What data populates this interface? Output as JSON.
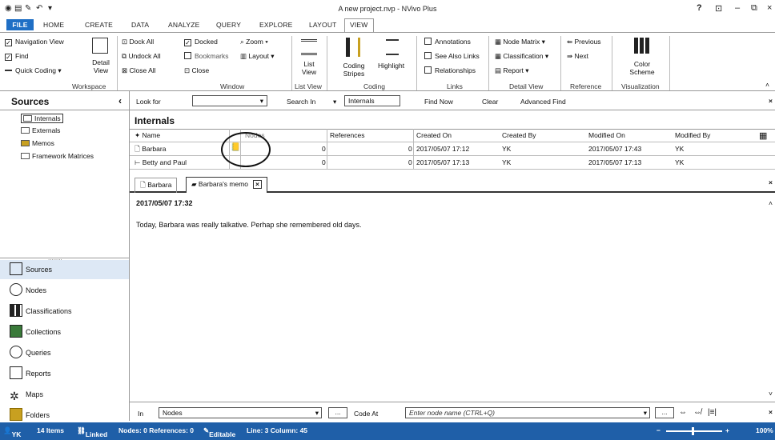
{
  "window": {
    "title": "A new project.nvp - NVivo Plus",
    "help": "?",
    "minimize": "–",
    "restore": "⊡",
    "close": "×"
  },
  "tabs": [
    "FILE",
    "HOME",
    "CREATE",
    "DATA",
    "ANALYZE",
    "QUERY",
    "EXPLORE",
    "LAYOUT",
    "VIEW"
  ],
  "active_tab": "VIEW",
  "ribbon": {
    "workspace": {
      "label": "Workspace",
      "items": [
        "Navigation View",
        "Find",
        "Quick Coding"
      ],
      "detail_view": "Detail View"
    },
    "window": {
      "label": "Window",
      "items": [
        "Dock All",
        "Undock All",
        "Close All",
        "Docked",
        "Bookmarks",
        "Close",
        "Zoom",
        "Layout"
      ]
    },
    "list_view": {
      "label": "List View",
      "button": "List View"
    },
    "coding": {
      "label": "Coding",
      "stripes": "Coding Stripes",
      "highlight": "Highlight"
    },
    "links": {
      "label": "Links",
      "items": [
        "Annotations",
        "See Also Links",
        "Relationships"
      ]
    },
    "detail_view": {
      "label": "Detail View",
      "items": [
        "Node Matrix",
        "Classification",
        "Report"
      ]
    },
    "reference": {
      "label": "Reference",
      "items": [
        "Previous",
        "Next"
      ]
    },
    "visualization": {
      "label": "Visualization",
      "button": "Color Scheme"
    }
  },
  "sources": {
    "header": "Sources",
    "tree": [
      "Internals",
      "Externals",
      "Memos",
      "Framework Matrices"
    ]
  },
  "nav": [
    "Sources",
    "Nodes",
    "Classifications",
    "Collections",
    "Queries",
    "Reports",
    "Maps",
    "Folders"
  ],
  "findbar": {
    "look_for": "Look for",
    "search_in": "Search In",
    "search_in_value": "Internals",
    "find_now": "Find Now",
    "clear": "Clear",
    "advanced": "Advanced Find"
  },
  "list": {
    "title": "Internals",
    "columns": [
      "Name",
      "Nodes",
      "References",
      "Created On",
      "Created By",
      "Modified On",
      "Modified By"
    ],
    "rows": [
      {
        "name": "Barbara",
        "nodes": "0",
        "references": "0",
        "created_on": "2017/05/07 17:12",
        "created_by": "YK",
        "modified_on": "2017/05/07 17:43",
        "modified_by": "YK"
      },
      {
        "name": "Betty and Paul",
        "nodes": "0",
        "references": "0",
        "created_on": "2017/05/07 17:13",
        "created_by": "YK",
        "modified_on": "2017/05/07 17:13",
        "modified_by": "YK"
      }
    ]
  },
  "doc_tabs": [
    "Barbara",
    "Barbara's memo"
  ],
  "doc": {
    "timestamp": "2017/05/07 17:32",
    "text": "Today, Barbara was really talkative. Perhap she remembered old days."
  },
  "bottombar": {
    "in": "In",
    "in_value": "Nodes",
    "code_at": "Code At",
    "placeholder": "Enter node name (CTRL+Q)",
    "more": "..."
  },
  "status": {
    "user": "YK",
    "items": "14 Items",
    "linked": "Linked",
    "nodes_refs": "Nodes: 0  References: 0",
    "editable": "Editable",
    "line_col": "Line: 3  Column: 45",
    "zoom": "100%"
  }
}
